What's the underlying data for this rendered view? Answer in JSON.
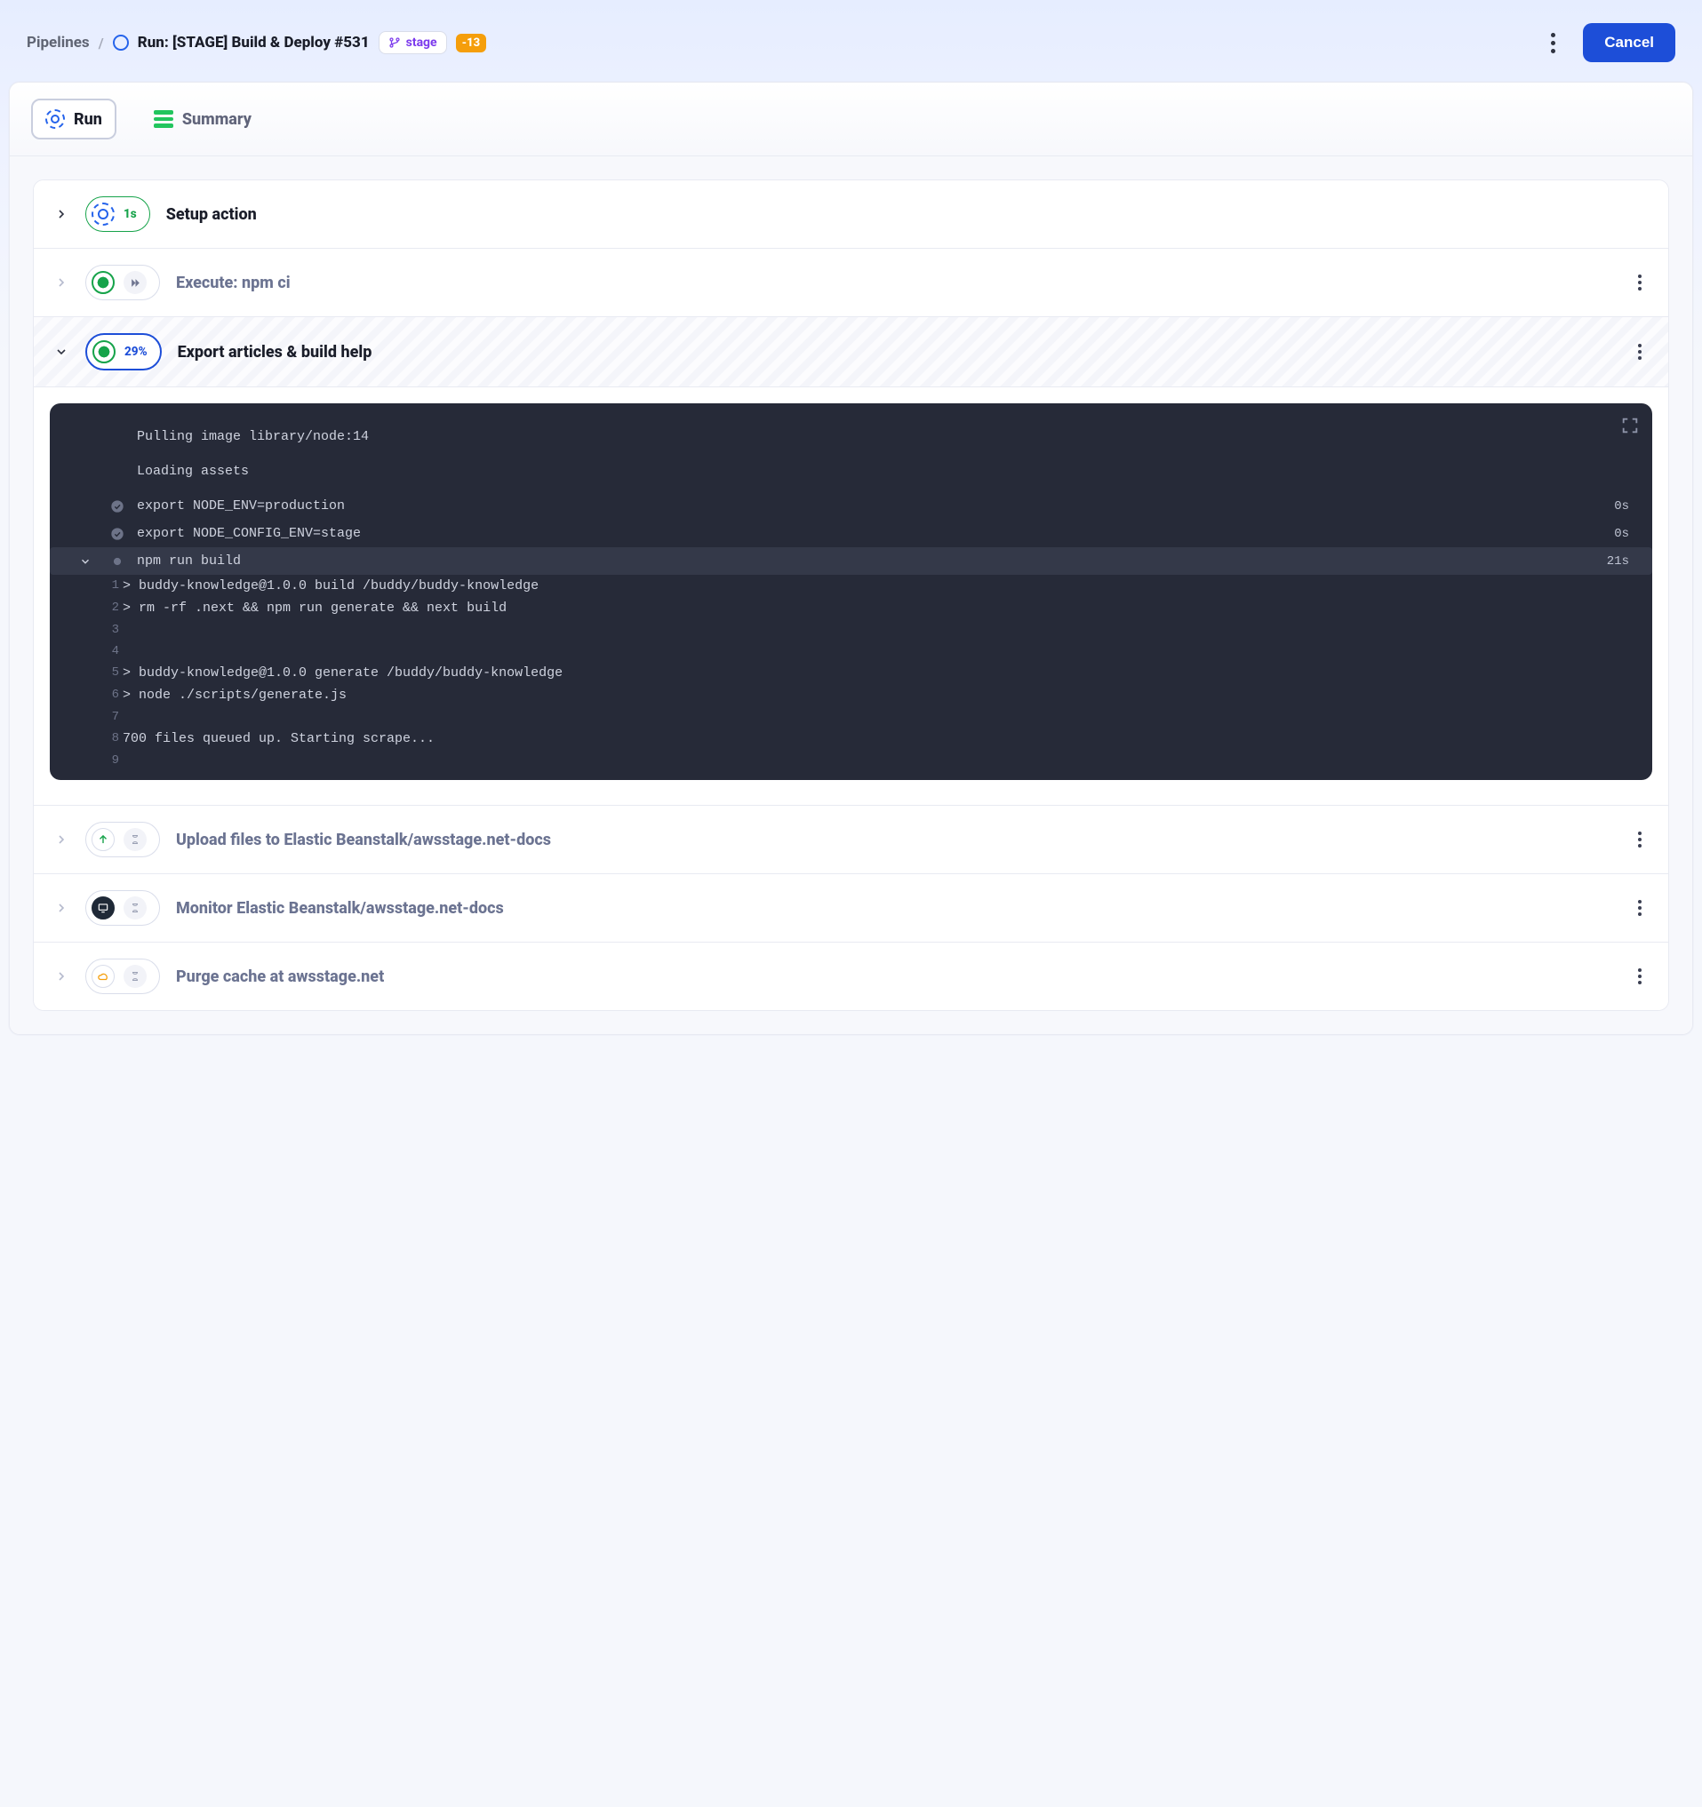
{
  "breadcrumb": {
    "root": "Pipelines",
    "title": "Run: [STAGE] Build & Deploy #531",
    "branch": "stage",
    "count": "-13"
  },
  "header": {
    "cancel": "Cancel"
  },
  "tabs": {
    "run": "Run",
    "summary": "Summary"
  },
  "actions": {
    "a0": {
      "title": "Setup action",
      "badge": "1s"
    },
    "a1": {
      "title": "Execute: npm ci"
    },
    "a2": {
      "title": "Export articles & build help",
      "badge": "29%"
    },
    "a3": {
      "title": "Upload files to Elastic Beanstalk/awsstage.net-docs"
    },
    "a4": {
      "title": "Monitor Elastic Beanstalk/awsstage.net-docs"
    },
    "a5": {
      "title": "Purge cache at awsstage.net"
    }
  },
  "log": {
    "pre0": "Pulling image library/node:14",
    "pre1": "Loading assets",
    "l0": {
      "text": "export NODE_ENV=production",
      "time": "0s"
    },
    "l1": {
      "text": "export NODE_CONFIG_ENV=stage",
      "time": "0s"
    },
    "l2": {
      "text": "npm run build",
      "time": "21s"
    },
    "out": {
      "1": "> buddy-knowledge@1.0.0 build /buddy/buddy-knowledge",
      "2": "> rm -rf .next && npm run generate && next build",
      "3": "",
      "4": "",
      "5": "> buddy-knowledge@1.0.0 generate /buddy/buddy-knowledge",
      "6": "> node ./scripts/generate.js",
      "7": "",
      "8": "700 files queued up. Starting scrape...",
      "9": ""
    }
  }
}
